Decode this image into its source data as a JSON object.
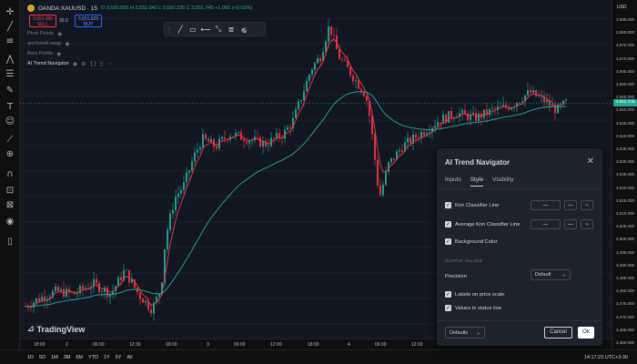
{
  "header": {
    "symbol_title": "OANDA:XAUUSD · 15",
    "ohlc": "O 3,550.550  H 3,552.040  L 3,550.335  C 3,551.745  +1.000 (+0.03%)",
    "sell_price": "3,551.385",
    "sell_label": "SELL",
    "spread": "36.0",
    "buy_price": "3,551.825",
    "buy_label": "BUY",
    "legends": [
      "Pivot Points",
      "anchored vwap",
      "Bars Points",
      "AI Trend Navigator"
    ]
  },
  "drawing_toolbar": {
    "tools": [
      "trend-line-icon",
      "rectangle-icon",
      "horizontal-ray-icon",
      "arrow-down-icon",
      "fib-icon",
      "pitchfork-icon"
    ]
  },
  "left_toolbar": {
    "tools": [
      "crosshair-icon",
      "trend-line-icon",
      "fib-icon",
      "brush-icon",
      "text-icon",
      "pattern-icon",
      "ruler-icon",
      "zoom-icon",
      "magnet-icon",
      "lock-icon",
      "eye-icon",
      "trash-icon"
    ]
  },
  "price_scale": {
    "currency": "USD",
    "current_price": "3,551.745",
    "ticks": [
      "3,585.000",
      "3,580.000",
      "3,575.000",
      "3,570.000",
      "3,565.000",
      "3,560.000",
      "3,555.000",
      "3,550.000",
      "3,545.000",
      "3,540.000",
      "3,535.000",
      "3,530.000",
      "3,525.000",
      "3,520.000",
      "3,515.000",
      "3,510.000",
      "3,505.000",
      "3,500.000",
      "3,495.000",
      "3,490.000",
      "3,485.000",
      "3,480.000",
      "3,475.000",
      "3,470.000",
      "3,465.000",
      "3,460.000"
    ]
  },
  "time_scale": {
    "ticks": [
      "18:00",
      "2",
      "06:00",
      "12:30",
      "18:00",
      "3",
      "06:00",
      "12:00",
      "18:00",
      "4",
      "06:00",
      "12:00"
    ]
  },
  "bottom_bar": {
    "ranges": [
      "1D",
      "5D",
      "1M",
      "3M",
      "6M",
      "YTD",
      "1Y",
      "5Y",
      "All"
    ],
    "clock": "14:17:23 UTC+3:30"
  },
  "branding": {
    "logo_text": "TradingView"
  },
  "dialog": {
    "title": "AI Trend Navigator",
    "tabs": [
      "Inputs",
      "Style",
      "Visibility"
    ],
    "active_tab": "Style",
    "rows": [
      {
        "label": "Knn Classifier Line",
        "checked": true
      },
      {
        "label": "Average Knn Classifier Line",
        "checked": true
      },
      {
        "label": "Background Color",
        "checked": true
      }
    ],
    "section_label": "OUTPUT VALUES",
    "precision_label": "Precision",
    "precision_value": "Default",
    "scale_labels": "Labels on price scale",
    "status_values": "Values in status line",
    "defaults_label": "Defaults",
    "cancel_label": "Cancel",
    "ok_label": "Ok"
  },
  "colors": {
    "up": "#22ab94",
    "down": "#f23645",
    "knn_line": "#f23645",
    "avg_knn_line": "#26a69a",
    "background": "#131722"
  }
}
